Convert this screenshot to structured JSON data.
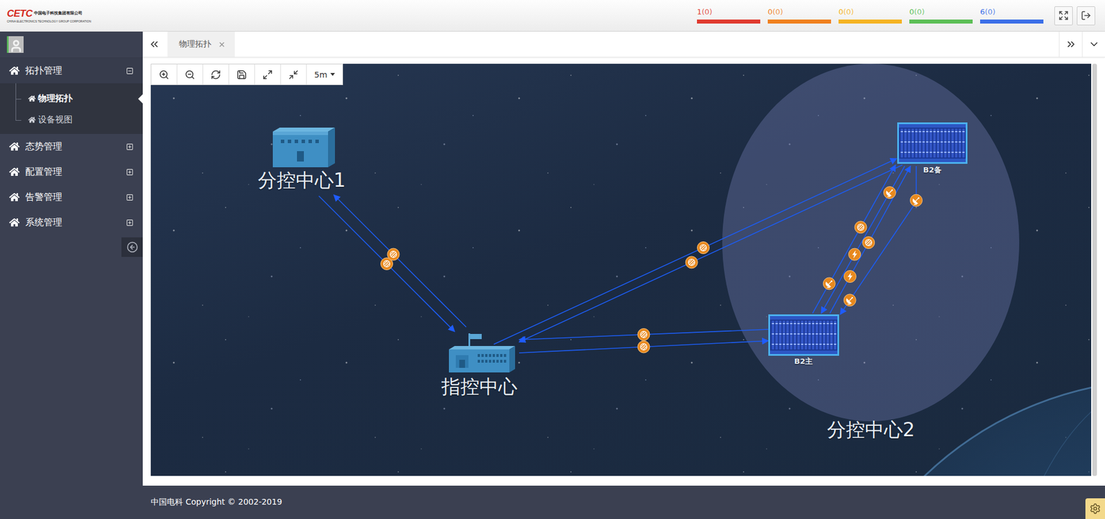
{
  "header": {
    "logo": {
      "mark": "CETC",
      "name_cn": "中国电子科技集团有限公司",
      "name_en": "CHINA ELECTRONICS TECHNOLOGY GROUP CORPORATION"
    },
    "alarms": [
      {
        "count": "1",
        "pending": "(0)",
        "color": "#e03a2f"
      },
      {
        "count": "0",
        "pending": "(0)",
        "color": "#f0811f"
      },
      {
        "count": "0",
        "pending": "(0)",
        "color": "#f5b323"
      },
      {
        "count": "0",
        "pending": "(0)",
        "color": "#5cbf56"
      },
      {
        "count": "6",
        "pending": "(0)",
        "color": "#3b6fe8"
      }
    ]
  },
  "sidebar": {
    "items": [
      {
        "label": "拓扑管理",
        "expanded": true,
        "children": [
          {
            "label": "物理拓扑",
            "selected": true
          },
          {
            "label": "设备视图",
            "selected": false
          }
        ]
      },
      {
        "label": "态势管理",
        "expanded": false,
        "children": []
      },
      {
        "label": "配置管理",
        "expanded": false,
        "children": []
      },
      {
        "label": "告警管理",
        "expanded": false,
        "children": []
      },
      {
        "label": "系统管理",
        "expanded": false,
        "children": []
      }
    ]
  },
  "tabs": [
    {
      "label": "物理拓扑",
      "selected": true
    }
  ],
  "toolbar": {
    "interval": "5m"
  },
  "topology": {
    "nodes": [
      {
        "label": "分控中心1",
        "kind": "building"
      },
      {
        "label": "指控中心",
        "kind": "command"
      },
      {
        "label": "B2备",
        "kind": "rack"
      },
      {
        "label": "B2主",
        "kind": "rack"
      }
    ],
    "groups": [
      {
        "label": "分控中心2"
      }
    ],
    "links": [
      {
        "markers": [
          {
            "kind": "optical"
          }
        ]
      },
      {
        "markers": [
          {
            "kind": "optical"
          }
        ]
      },
      {
        "markers": [
          {
            "kind": "optical"
          }
        ]
      },
      {
        "markers": [
          {
            "kind": "optical"
          }
        ]
      },
      {
        "markers": [
          {
            "kind": "optical"
          }
        ]
      },
      {
        "markers": [
          {
            "kind": "optical"
          }
        ]
      },
      {
        "markers": [
          {
            "kind": "satellite"
          },
          {
            "kind": "optical"
          }
        ]
      },
      {
        "markers": [
          {
            "kind": "satellite"
          },
          {
            "kind": "wireless"
          }
        ]
      },
      {
        "markers": [
          {
            "kind": "wireless"
          },
          {
            "kind": "optical"
          }
        ]
      },
      {
        "markers": [
          {
            "kind": "satellite"
          },
          {
            "kind": "satellite"
          }
        ]
      }
    ]
  },
  "footer": {
    "copyright": "中国电科 Copyright © 2002-2019"
  }
}
